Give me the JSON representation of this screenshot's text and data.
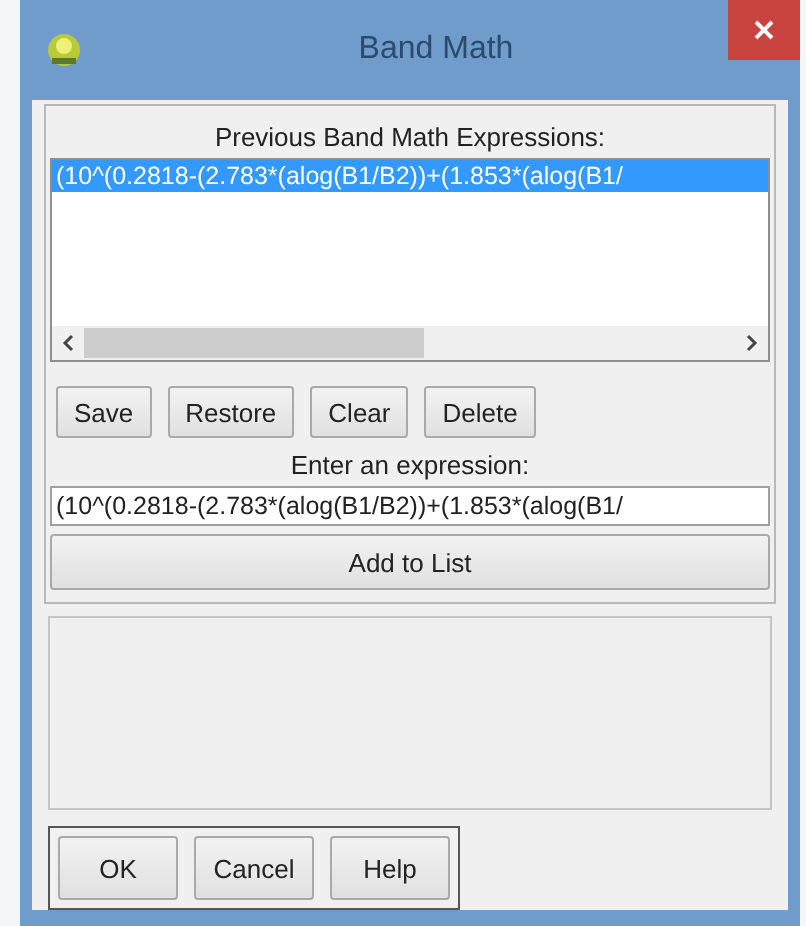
{
  "window": {
    "title": "Band Math"
  },
  "history": {
    "label": "Previous Band Math Expressions:",
    "items": [
      {
        "text": "(10^(0.2818-(2.783*(alog(B1/B2))+(1.853*(alog(B1/",
        "selected": true
      }
    ]
  },
  "history_buttons": [
    "Save",
    "Restore",
    "Clear",
    "Delete"
  ],
  "expression": {
    "label": "Enter an expression:",
    "value": "(10^(0.2818-(2.783*(alog(B1/B2))+(1.853*(alog(B1/"
  },
  "add_button": "Add to List",
  "dialog_buttons": [
    "OK",
    "Cancel",
    "Help"
  ]
}
